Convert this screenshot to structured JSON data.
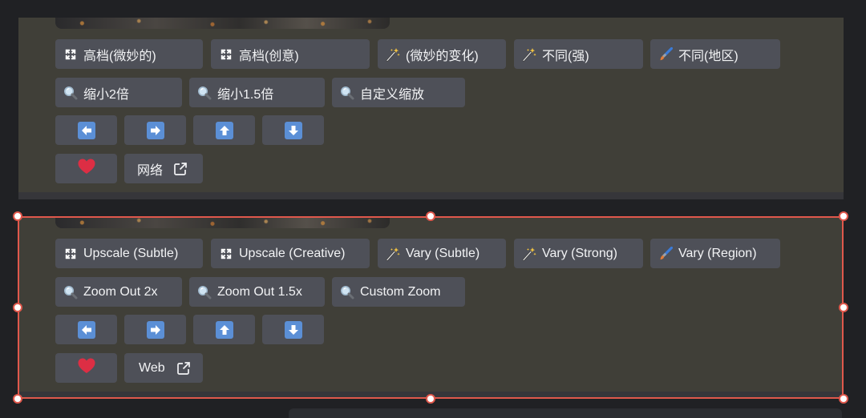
{
  "colors": {
    "page_bg": "#202124",
    "panel_bg": "#403f38",
    "button_bg": "#4e5058",
    "button_text": "#f2f3f5",
    "arrow_blue": "#5b8fd6",
    "heart_red": "#dd2e44",
    "selection": "#e0584c"
  },
  "zh": {
    "upscale_subtle": "高档(微妙的)",
    "upscale_creative": "高档(创意)",
    "vary_subtle": "(微妙的变化)",
    "vary_strong": "不同(强)",
    "vary_region": "不同(地区)",
    "zoom_out_2x": "缩小2倍",
    "zoom_out_1_5x": "缩小1.5倍",
    "custom_zoom": "自定义缩放",
    "web": "网络"
  },
  "en": {
    "upscale_subtle": "Upscale (Subtle)",
    "upscale_creative": "Upscale (Creative)",
    "vary_subtle": "Vary (Subtle)",
    "vary_strong": "Vary (Strong)",
    "vary_region": "Vary (Region)",
    "zoom_out_2x": "Zoom Out 2x",
    "zoom_out_1_5x": "Zoom Out 1.5x",
    "custom_zoom": "Custom Zoom",
    "web": "Web"
  },
  "icons": {
    "upscale": "expand-arrows-icon",
    "vary": "magic-wand-icon",
    "region": "paintbrush-icon",
    "zoom": "magnifier-icon",
    "pan_left": "arrow-left-icon",
    "pan_right": "arrow-right-icon",
    "pan_up": "arrow-up-icon",
    "pan_down": "arrow-down-icon",
    "favorite": "heart-icon",
    "external": "external-link-icon"
  }
}
